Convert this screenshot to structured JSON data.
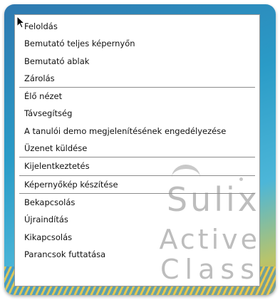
{
  "watermark": {
    "line1": "Sulix",
    "line2": "Active",
    "line3": "Class",
    "registered_mark": "®"
  },
  "menu": {
    "groups": [
      [
        "Feloldás",
        "Bemutató teljes képernyőn",
        "Bemutató ablak",
        "Zárolás"
      ],
      [
        "Élő nézet",
        "Távsegítség",
        "A tanulói demo megjelenítésének engedélyezése",
        "Üzenet küldése"
      ],
      [
        "Kijelentkeztetés"
      ],
      [
        "Képernyőkép készítése"
      ],
      [
        "Bekapcsolás",
        "Újraindítás",
        "Kikapcsolás",
        "Parancsok futtatása"
      ]
    ]
  }
}
